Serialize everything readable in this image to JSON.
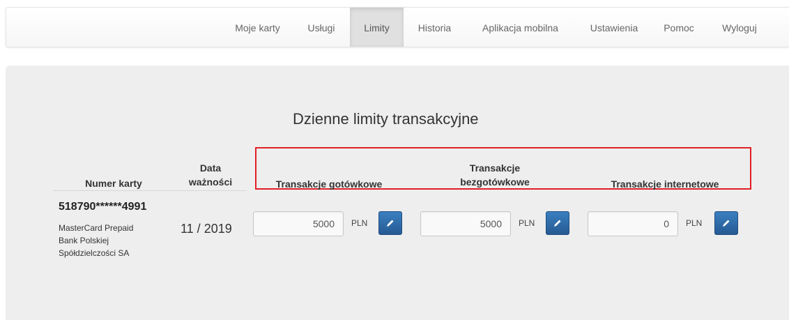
{
  "nav": {
    "items": [
      {
        "label": "Moje karty",
        "active": false
      },
      {
        "label": "Usługi",
        "active": false
      },
      {
        "label": "Limity",
        "active": true
      },
      {
        "label": "Historia",
        "active": false
      },
      {
        "label": "Aplikacja mobilna",
        "active": false
      },
      {
        "label": "Ustawienia",
        "active": false
      },
      {
        "label": "Pomoc",
        "active": false
      },
      {
        "label": "Wyloguj",
        "active": false
      }
    ]
  },
  "page": {
    "title": "Dzienne limity transakcyjne"
  },
  "table": {
    "headers": {
      "card_number": "Numer karty",
      "expiry_line1": "Data",
      "expiry_line2": "ważności",
      "cash": "Transakcje gotówkowe",
      "cashless_line1": "Transakcje",
      "cashless_line2": "bezgotówkowe",
      "internet": "Transakcje internetowe"
    },
    "row": {
      "card_number": "518790******4991",
      "card_desc_lines": [
        "MasterCard Prepaid",
        "Bank Polskiej",
        "Spółdzielczości SA"
      ],
      "expiry": "11 / 2019",
      "limits": {
        "cash": {
          "value": "5000",
          "currency": "PLN"
        },
        "cashless": {
          "value": "5000",
          "currency": "PLN"
        },
        "internet": {
          "value": "0",
          "currency": "PLN"
        }
      }
    }
  },
  "icons": {
    "edit": "pencil-icon"
  },
  "colors": {
    "highlight": "#e01f26",
    "edit_button": "#2a6aa8",
    "panel": "#eeeeee"
  }
}
